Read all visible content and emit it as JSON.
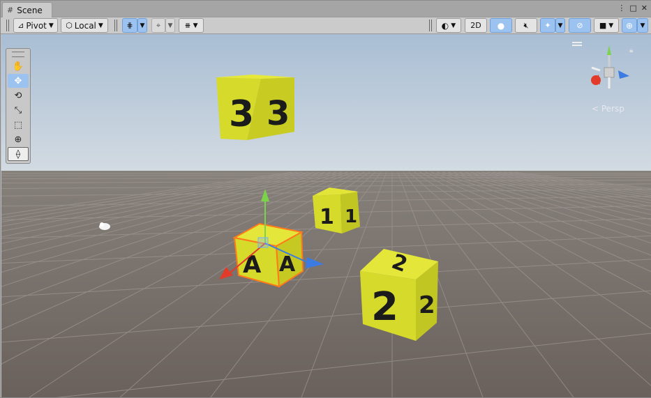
{
  "window": {
    "tab_title": "Scene",
    "tab_icon": "grid-icon",
    "controls": [
      "⋮",
      "□",
      "✕"
    ]
  },
  "toolbar": {
    "pivot_label": "Pivot",
    "local_label": "Local",
    "mode_2d_label": "2D"
  },
  "tools": [
    {
      "name": "hand-tool",
      "icon": "hand-icon",
      "glyph": "✋",
      "active": false
    },
    {
      "name": "move-tool",
      "icon": "move-arrows-icon",
      "glyph": "✥",
      "active": true
    },
    {
      "name": "rotate-tool",
      "icon": "rotate-icon",
      "glyph": "⟲",
      "active": false
    },
    {
      "name": "scale-tool",
      "icon": "scale-icon",
      "glyph": "⤡",
      "active": false
    },
    {
      "name": "rect-tool",
      "icon": "rect-icon",
      "glyph": "⬚",
      "active": false
    },
    {
      "name": "transform-tool",
      "icon": "transform-icon",
      "glyph": "⊕",
      "active": false
    },
    {
      "name": "custom-editor-tool",
      "icon": "custom-tool-icon",
      "glyph": "⟠",
      "active": false
    }
  ],
  "viewport": {
    "projection_label": "< Persp",
    "cubes": [
      {
        "label": "3",
        "name": "cube-3"
      },
      {
        "label": "1",
        "name": "cube-1"
      },
      {
        "label": "A",
        "name": "cube-a-selected"
      },
      {
        "label": "2",
        "name": "cube-2"
      }
    ]
  },
  "colors": {
    "cube_yellow": "#d8dc2a",
    "selection_orange": "#ff7a1a",
    "axis_x": "#e23b2a",
    "axis_y": "#7bd34a",
    "axis_z": "#3b7be2",
    "active_blue": "#9cc3f0"
  }
}
